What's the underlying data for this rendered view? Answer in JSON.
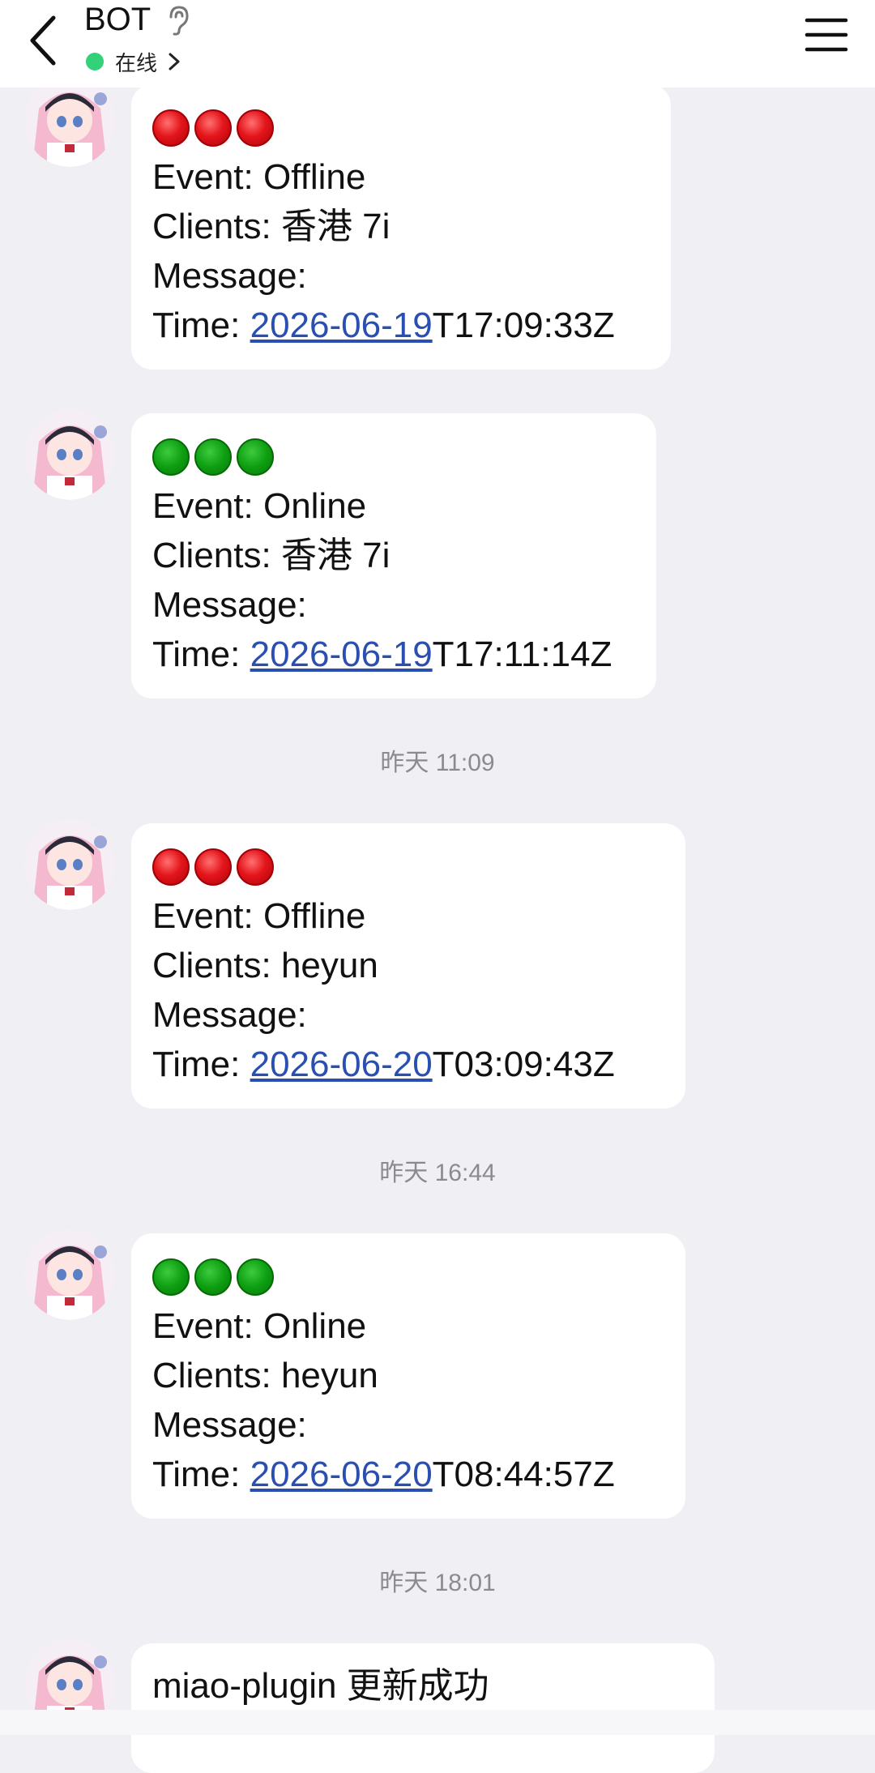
{
  "header": {
    "title": "BOT",
    "status": "在线",
    "colors": {
      "status_dot": "#33d17a"
    }
  },
  "messages": [
    {
      "type": "event",
      "dots": "red",
      "event": "Event: Offline",
      "clients": "Clients: 香港 7i",
      "message": "Message:",
      "time_prefix": "Time: ",
      "date": "2026-06-19",
      "time_suffix": "T17:09:33Z"
    },
    {
      "type": "event",
      "dots": "green",
      "event": "Event: Online",
      "clients": "Clients: 香港 7i",
      "message": "Message:",
      "time_prefix": "Time: ",
      "date": "2026-06-19",
      "time_suffix": "T17:11:14Z"
    },
    {
      "type": "timestamp",
      "text": "昨天 11:09"
    },
    {
      "type": "event",
      "dots": "red",
      "event": "Event: Offline",
      "clients": "Clients: heyun",
      "message": "Message:",
      "time_prefix": "Time: ",
      "date": "2026-06-20",
      "time_suffix": "T03:09:43Z"
    },
    {
      "type": "timestamp",
      "text": "昨天 16:44"
    },
    {
      "type": "event",
      "dots": "green",
      "event": "Event: Online",
      "clients": "Clients: heyun",
      "message": "Message:",
      "time_prefix": "Time: ",
      "date": "2026-06-20",
      "time_suffix": "T08:44:57Z"
    },
    {
      "type": "timestamp",
      "text": "昨天 18:01"
    },
    {
      "type": "text",
      "text": "miao-plugin 更新成功"
    }
  ]
}
